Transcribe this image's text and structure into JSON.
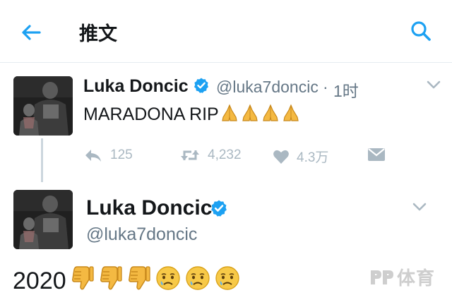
{
  "header": {
    "title": "推文",
    "back_icon": "back-arrow-icon",
    "search_icon": "search-icon",
    "accent_color": "#1da1f2"
  },
  "tweet_reply": {
    "author_name": "Luka Doncic",
    "handle": "@luka7doncic",
    "separator": "·",
    "time": "1时",
    "text": "MARADONA RIP",
    "emojis": [
      "folded-hands-emoji",
      "folded-hands-emoji",
      "folded-hands-emoji",
      "folded-hands-emoji"
    ],
    "replies": "125",
    "retweets": "4,232",
    "likes": "4.3万"
  },
  "tweet_main": {
    "author_name": "Luka Doncic",
    "handle": "@luka7doncic",
    "text": "2020",
    "emojis": [
      "thumbs-down-emoji",
      "thumbs-down-emoji",
      "thumbs-down-emoji",
      "crying-face-emoji",
      "crying-face-emoji",
      "crying-face-emoji"
    ]
  },
  "watermark": {
    "text": "体育"
  }
}
